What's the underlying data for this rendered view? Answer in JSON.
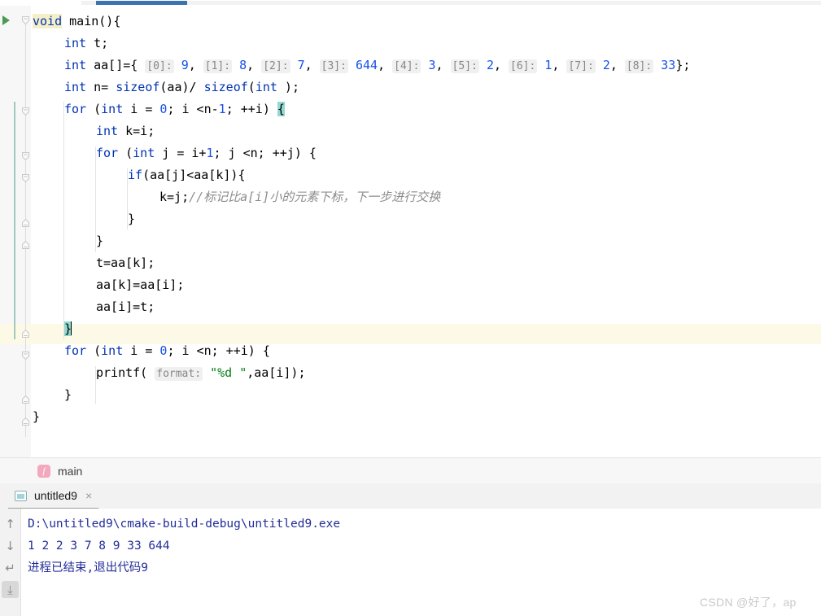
{
  "editor": {
    "code_lines": [
      {
        "indent": 0,
        "segments": [
          {
            "t": "void",
            "c": "kw hl-id"
          },
          {
            "t": " "
          },
          {
            "t": "main",
            "c": ""
          },
          {
            "t": "(){"
          }
        ]
      },
      {
        "indent": 1,
        "segments": [
          {
            "t": "int",
            "c": "kw"
          },
          {
            "t": " t;"
          }
        ]
      },
      {
        "indent": 1,
        "segments": [
          {
            "t": "int",
            "c": "kw"
          },
          {
            "t": " aa[]={ "
          },
          {
            "t": "[0]:",
            "c": "inlay"
          },
          {
            "t": " "
          },
          {
            "t": "9",
            "c": "num"
          },
          {
            "t": ", "
          },
          {
            "t": "[1]:",
            "c": "inlay"
          },
          {
            "t": " "
          },
          {
            "t": "8",
            "c": "num"
          },
          {
            "t": ", "
          },
          {
            "t": "[2]:",
            "c": "inlay"
          },
          {
            "t": " "
          },
          {
            "t": "7",
            "c": "num"
          },
          {
            "t": ", "
          },
          {
            "t": "[3]:",
            "c": "inlay"
          },
          {
            "t": " "
          },
          {
            "t": "644",
            "c": "num"
          },
          {
            "t": ", "
          },
          {
            "t": "[4]:",
            "c": "inlay"
          },
          {
            "t": " "
          },
          {
            "t": "3",
            "c": "num"
          },
          {
            "t": ", "
          },
          {
            "t": "[5]:",
            "c": "inlay"
          },
          {
            "t": " "
          },
          {
            "t": "2",
            "c": "num"
          },
          {
            "t": ", "
          },
          {
            "t": "[6]:",
            "c": "inlay"
          },
          {
            "t": " "
          },
          {
            "t": "1",
            "c": "num"
          },
          {
            "t": ", "
          },
          {
            "t": "[7]:",
            "c": "inlay"
          },
          {
            "t": " "
          },
          {
            "t": "2",
            "c": "num"
          },
          {
            "t": ", "
          },
          {
            "t": "[8]:",
            "c": "inlay"
          },
          {
            "t": " "
          },
          {
            "t": "33",
            "c": "num"
          },
          {
            "t": "};"
          }
        ]
      },
      {
        "indent": 1,
        "segments": [
          {
            "t": "int",
            "c": "kw"
          },
          {
            "t": " n= "
          },
          {
            "t": "sizeof",
            "c": "kw"
          },
          {
            "t": "(aa)/ "
          },
          {
            "t": "sizeof",
            "c": "kw"
          },
          {
            "t": "("
          },
          {
            "t": "int",
            "c": "kw"
          },
          {
            "t": " );"
          }
        ]
      },
      {
        "indent": 1,
        "segments": [
          {
            "t": "for",
            "c": "kw"
          },
          {
            "t": " ("
          },
          {
            "t": "int",
            "c": "kw"
          },
          {
            "t": " i = "
          },
          {
            "t": "0",
            "c": "num"
          },
          {
            "t": "; i <n-"
          },
          {
            "t": "1",
            "c": "num"
          },
          {
            "t": "; ++i) "
          },
          {
            "t": "{",
            "c": "brace-match"
          }
        ]
      },
      {
        "indent": 2,
        "segments": [
          {
            "t": "int",
            "c": "kw"
          },
          {
            "t": " k=i;"
          }
        ]
      },
      {
        "indent": 2,
        "segments": [
          {
            "t": "for",
            "c": "kw"
          },
          {
            "t": " ("
          },
          {
            "t": "int",
            "c": "kw"
          },
          {
            "t": " j = i+"
          },
          {
            "t": "1",
            "c": "num"
          },
          {
            "t": "; j <n; ++j) {"
          }
        ]
      },
      {
        "indent": 3,
        "segments": [
          {
            "t": "if",
            "c": "kw"
          },
          {
            "t": "(aa[j]<aa[k]){"
          }
        ]
      },
      {
        "indent": 4,
        "segments": [
          {
            "t": "k=j;"
          },
          {
            "t": "//标记比a[i]小的元素下标，下一步进行交换",
            "c": "cmt"
          }
        ]
      },
      {
        "indent": 3,
        "segments": [
          {
            "t": "}"
          }
        ]
      },
      {
        "indent": 2,
        "segments": [
          {
            "t": "}"
          }
        ]
      },
      {
        "indent": 2,
        "segments": [
          {
            "t": "t=aa[k];"
          }
        ]
      },
      {
        "indent": 2,
        "segments": [
          {
            "t": "aa[k]=aa[i];"
          }
        ]
      },
      {
        "indent": 2,
        "segments": [
          {
            "t": "aa[i]=t;"
          }
        ]
      },
      {
        "indent": 1,
        "segments": [
          {
            "t": "}",
            "c": "brace-match"
          },
          {
            "t": "",
            "c": "caret-slot"
          }
        ]
      },
      {
        "indent": 1,
        "segments": [
          {
            "t": "for",
            "c": "kw"
          },
          {
            "t": " ("
          },
          {
            "t": "int",
            "c": "kw"
          },
          {
            "t": " i = "
          },
          {
            "t": "0",
            "c": "num"
          },
          {
            "t": "; i <n; ++i) {"
          }
        ]
      },
      {
        "indent": 2,
        "segments": [
          {
            "t": "printf( "
          },
          {
            "t": "format:",
            "c": "inlay"
          },
          {
            "t": " "
          },
          {
            "t": "\"%d \"",
            "c": "str"
          },
          {
            "t": ",aa[i]);"
          }
        ]
      },
      {
        "indent": 1,
        "segments": [
          {
            "t": "}"
          }
        ]
      },
      {
        "indent": 0,
        "segments": [
          {
            "t": "}"
          }
        ]
      }
    ],
    "caret_line_index": 14
  },
  "breadcrumb": {
    "icon_glyph": "f",
    "label": "main"
  },
  "run_window": {
    "tab_label": "untitled9",
    "close_glyph": "×",
    "toolbar": [
      {
        "name": "scroll-up-icon",
        "glyph": "↑",
        "active": false
      },
      {
        "name": "scroll-down-icon",
        "glyph": "↓",
        "active": false
      },
      {
        "name": "soft-wrap-icon",
        "glyph": "↵",
        "active": false
      },
      {
        "name": "scroll-to-end-icon",
        "glyph": "⤓",
        "active": true
      }
    ],
    "console_lines": [
      "D:\\untitled9\\cmake-build-debug\\untitled9.exe",
      "1 2 2 3 7 8 9 33 644",
      "进程已结束,退出代码9"
    ]
  },
  "watermark": {
    "text": "CSDN @好了，ap"
  },
  "colors": {
    "keyword": "#0033b3",
    "number": "#1750eb",
    "string": "#067d17",
    "comment": "#8c8c8c",
    "brace_match": "#93d9d0",
    "caret_line": "#fdf9e7",
    "console_text": "#232d99",
    "scrollbar_thumb": "#3b72b0",
    "breadcrumb_icon": "#f4a8bd"
  }
}
